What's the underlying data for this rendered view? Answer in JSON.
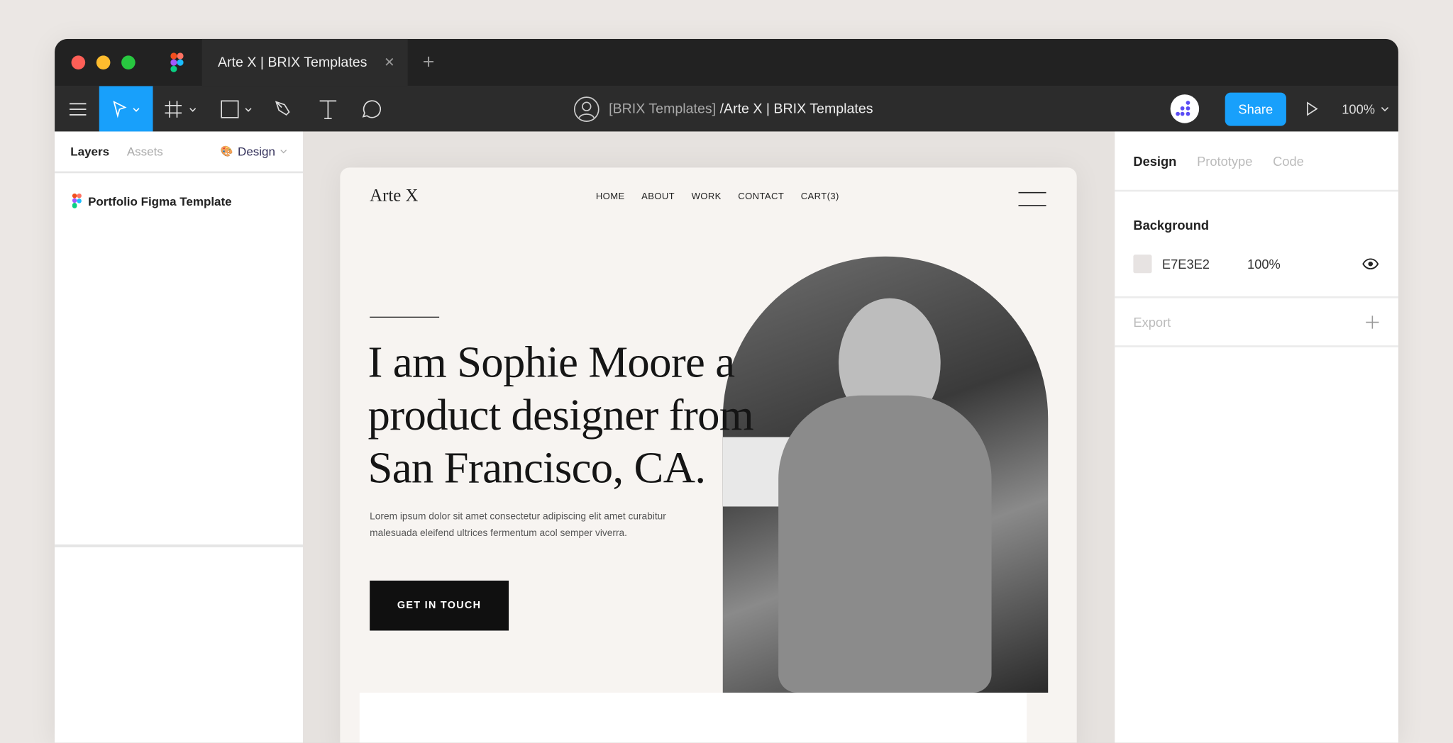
{
  "window": {
    "tab_title": "Arte X | BRIX Templates",
    "close": "✕",
    "new_tab": "+",
    "traffic": [
      "#ff5f57",
      "#febc2e",
      "#28c840"
    ]
  },
  "toolbar": {
    "breadcrumb_team": "[BRIX Templates]",
    "breadcrumb_file": "/Arte X | BRIX Templates",
    "share": "Share",
    "zoom": "100%",
    "accent": "#18a0fb"
  },
  "left_panel": {
    "tabs": [
      "Layers",
      "Assets"
    ],
    "page": "Design",
    "layers": [
      {
        "name": "Portfolio Figma Template"
      }
    ]
  },
  "frame": {
    "logo": "Arte X",
    "nav": [
      "HOME",
      "ABOUT",
      "WORK",
      "CONTACT",
      "CART(3)"
    ],
    "headline": [
      "I am Sophie Moore a",
      "product designer from",
      "San Francisco, CA."
    ],
    "paragraph": [
      "Lorem ipsum dolor sit amet consectetur adipiscing elit amet curabitur",
      "malesuada eleifend ultrices fermentum acol semper viverra."
    ],
    "cta": "GET IN TOUCH"
  },
  "right_panel": {
    "tabs": [
      "Design",
      "Prototype",
      "Code"
    ],
    "background_label": "Background",
    "bg_hex": "E7E3E2",
    "bg_color": "#E7E3E2",
    "bg_opacity": "100%",
    "export_label": "Export"
  }
}
